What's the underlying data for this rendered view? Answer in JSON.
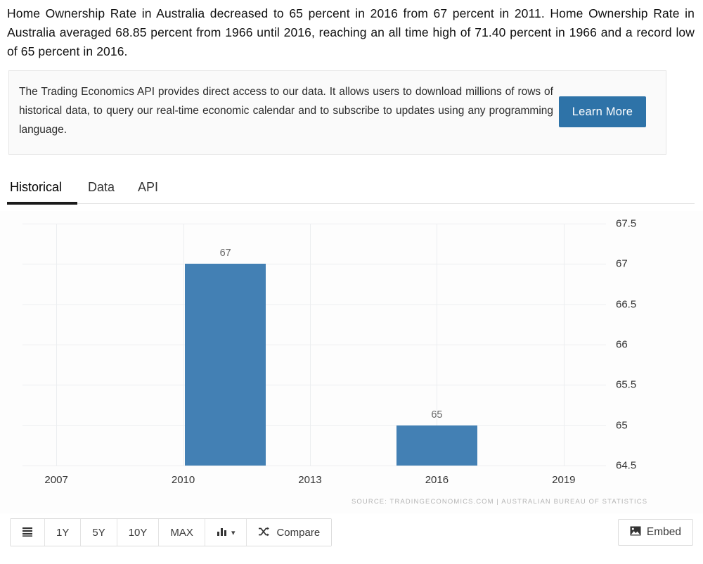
{
  "intro": {
    "text": "Home Ownership Rate in Australia decreased to 65 percent in 2016 from 67 percent in 2011. Home Ownership Rate in Australia averaged 68.85 percent from 1966 until 2016, reaching an all time high of 71.40 percent in 1966 and a record low of 65 percent in 2016."
  },
  "banner": {
    "text": "The Trading Economics API provides direct access to our data. It allows users to download millions of rows of historical data, to query our real-time economic calendar and to subscribe to updates using any programming language.",
    "button_label": "Learn More",
    "button_color": "#2e73a8"
  },
  "tabs": [
    {
      "label": "Historical",
      "active": true
    },
    {
      "label": "Data",
      "active": false
    },
    {
      "label": "API",
      "active": false
    }
  ],
  "chart_data": {
    "type": "bar",
    "title": "",
    "xlabel": "",
    "ylabel": "",
    "categories": [
      "2011",
      "2016"
    ],
    "values": [
      67,
      65
    ],
    "data_labels": [
      "67",
      "65"
    ],
    "ylim": [
      64.5,
      67.5
    ],
    "yticks": [
      "67.5",
      "67",
      "66.5",
      "66",
      "65.5",
      "65",
      "64.5"
    ],
    "ytick_values": [
      67.5,
      67,
      66.5,
      66,
      65.5,
      65,
      64.5
    ],
    "xticks": [
      "2007",
      "2010",
      "2013",
      "2016",
      "2019"
    ],
    "xtick_values": [
      2007,
      2010,
      2013,
      2016,
      2019
    ],
    "grid": true,
    "legend": false,
    "bar_color": "#4380b4",
    "source": "SOURCE: TRADINGECONOMICS.COM  |  AUSTRALIAN BUREAU OF STATISTICS"
  },
  "toolbar": {
    "list_icon": "list-icon",
    "ranges": [
      "1Y",
      "5Y",
      "10Y",
      "MAX"
    ],
    "chart_type_icon": "bar-chart-icon",
    "chart_type_caret": "▾",
    "compare_icon": "shuffle-icon",
    "compare_label": "Compare",
    "embed_icon": "image-icon",
    "embed_label": "Embed"
  }
}
